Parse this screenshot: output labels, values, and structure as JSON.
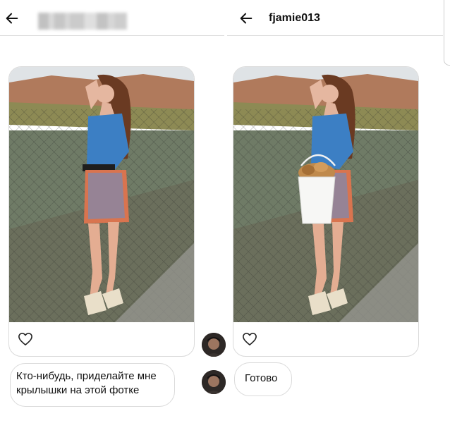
{
  "left_pane": {
    "recipient_name_hidden": true,
    "photo_caption_button": "like",
    "message": "Кто-нибудь, приделайте мне\nкрылышки на этой фотке"
  },
  "right_pane": {
    "username": "fjamie013",
    "photo_caption_button": "like",
    "message": "Готово"
  },
  "icons": {
    "back": "back-arrow-icon",
    "like": "heart-icon"
  },
  "colors": {
    "divider": "#dcdcdc",
    "bubble_border": "#dadada",
    "text": "#111111"
  }
}
